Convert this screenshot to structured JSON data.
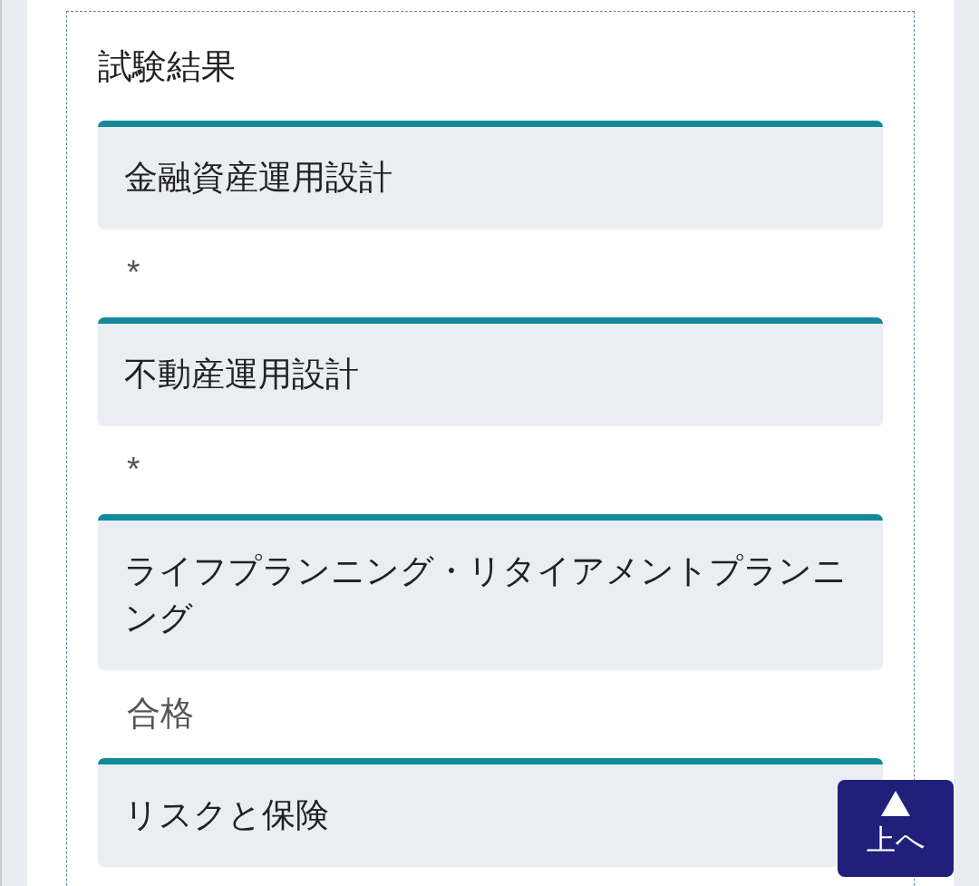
{
  "section": {
    "title": "試験結果",
    "subjects": [
      {
        "name": "金融資産運用設計",
        "result": "*"
      },
      {
        "name": "不動産運用設計",
        "result": "*"
      },
      {
        "name": "ライフプランニング・リタイアメントプランニング",
        "result": "合格"
      },
      {
        "name": "リスクと保険"
      }
    ]
  },
  "back_to_top_button": {
    "label": "上へ"
  }
}
